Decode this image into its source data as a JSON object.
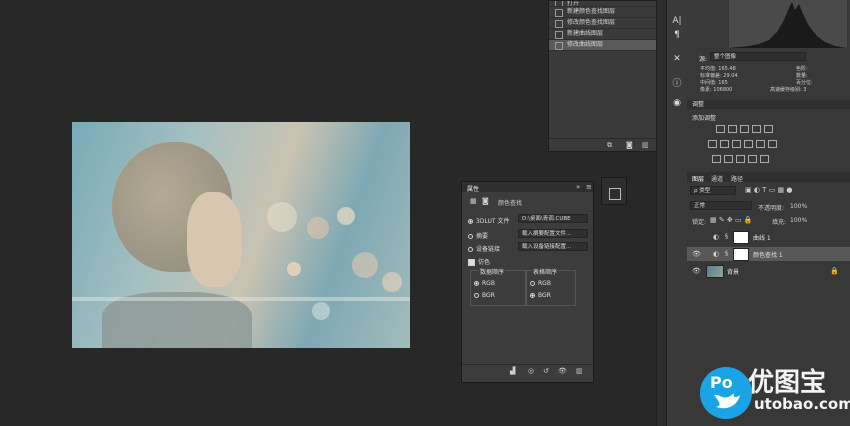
{
  "history": {
    "items": [
      "打开",
      "新建颜色查找图层",
      "修改颜色查找图层",
      "新建曲线图层",
      "修改曲线图层"
    ],
    "selected_index": 4
  },
  "tools": {
    "items": [
      "A|",
      "¶",
      "✕",
      "ⓘ",
      "◉"
    ]
  },
  "histogram": {
    "source_label": "源:",
    "source_value": "整个图像",
    "stats_left": [
      "平均值: 165.48",
      "标准偏差: 29.04",
      "中间值: 165",
      "像素: 106800"
    ],
    "stats_right": [
      "色阶:",
      "数量:",
      "百分位:",
      "高速缓存级别: 3"
    ]
  },
  "adjustments": {
    "title": "调整",
    "subtitle": "添加调整"
  },
  "layers": {
    "tabs": [
      "图层",
      "通道",
      "路径"
    ],
    "filter_label": "ρ 类型",
    "blend_mode": "正常",
    "opacity_label": "不透明度:",
    "opacity_value": "100%",
    "lock_label": "锁定:",
    "fill_label": "填充:",
    "fill_value": "100%",
    "items": [
      {
        "name": "曲线 1",
        "visible": false
      },
      {
        "name": "颜色查找 1",
        "visible": true
      },
      {
        "name": "背景",
        "visible": true
      }
    ]
  },
  "properties": {
    "title": "属性",
    "collapse_glyph": "»",
    "menu_glyph": "≡",
    "panel_name": "颜色查找",
    "lut_label": "3DLUT 文件",
    "lut_value": "D:\\桌面\\青调.CUBE",
    "abstract_label": "摘要",
    "abstract_value": "载入摘要配置文件...",
    "devlink_label": "设备链接",
    "devlink_value": "载入设备链接配置...",
    "dither_label": "仿色",
    "data_order_label": "数据顺序",
    "table_order_label": "表格顺序",
    "rgb": "RGB",
    "bgr": "BGR"
  },
  "watermark": {
    "prefix": "Po",
    "name": "优图宝",
    "url": "utobao.com"
  }
}
